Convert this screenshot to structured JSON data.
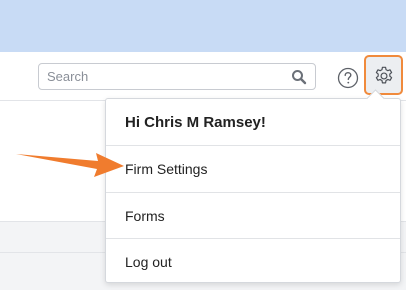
{
  "search": {
    "placeholder": "Search"
  },
  "user_menu": {
    "greeting": "Hi Chris M Ramsey!",
    "items": [
      {
        "label": "Firm Settings"
      },
      {
        "label": "Forms"
      },
      {
        "label": "Log out"
      }
    ]
  },
  "icons": {
    "search": "search-icon",
    "help": "help-icon",
    "settings": "gear-icon",
    "annotation": "arrow-pointer"
  },
  "colors": {
    "banner": "#c8dbf5",
    "highlight": "#f08a3c",
    "arrow": "#f07c2e"
  }
}
